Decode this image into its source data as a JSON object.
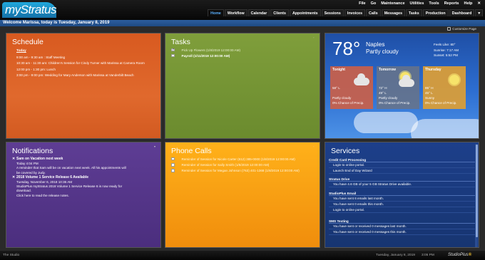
{
  "app": {
    "logo": "myStratus"
  },
  "top_menu": [
    "File",
    "Go",
    "Maintenance",
    "Utilities",
    "Tools",
    "Reports",
    "Help",
    "✕"
  ],
  "nav_tabs": [
    "Home",
    "Workflow",
    "Calendar",
    "Clients",
    "Appointments",
    "Sessions",
    "Invoices",
    "Calls",
    "Messages",
    "Tasks",
    "Production",
    "Dashboard",
    "▾"
  ],
  "active_tab": "Home",
  "welcome": "Welcome Marissa, today is Tuesday, January 8, 2019",
  "customize_label": "Customize Page",
  "schedule": {
    "title": "Schedule",
    "day_label": "Today",
    "items": [
      "9:00 am - 9:30 am : Staff Meeting",
      "10:30 am - 11:30 am: Children's Session for Cindy Turner with Marissa at Camera Room",
      "12:00 pm - 1:30 pm: Lunch",
      "3:00 pm - 9:00 pm: Wedding for Mary Anderson with Marissa at Vanderbilt Beach"
    ]
  },
  "tasks": {
    "title": "Tasks",
    "items": [
      {
        "label": "Pick Up Flowers (1/8/2019 12:00:00 AM)",
        "checked": true
      },
      {
        "label": "Payroll (1/11/2019 12:00:00 AM)",
        "checked": false
      }
    ]
  },
  "weather": {
    "temp": "78°",
    "city": "Naples",
    "condition": "Partly cloudy",
    "feels_like": "Feels Like: 80°",
    "sunrise": "Sunrise: 7:17 AM",
    "sunset": "Sunset: 5:52 PM",
    "forecast": [
      {
        "day": "Tonight",
        "hi": "58° L",
        "lo": "",
        "cond": "Partly cloudy",
        "precip": "0% Chance of Precip."
      },
      {
        "day": "Tomorrow",
        "hi": "72° H",
        "lo": "49° L",
        "cond": "Partly cloudy",
        "precip": "0% Chance of Precip."
      },
      {
        "day": "Thursday",
        "hi": "85° H",
        "lo": "45° L",
        "cond": "Sunny",
        "precip": "0% Chance of Precip."
      }
    ]
  },
  "notifications": {
    "title": "Notifications",
    "items": [
      {
        "title": "Sam on Vacation next week",
        "lines": [
          "Today 4:04 PM",
          "A reminder that Sam will be on vacation next week. All his appointments will",
          "be covered by Judy."
        ]
      },
      {
        "title": "2018 Volume 1 Service Release 6 Available",
        "lines": [
          "Tuesday, November 6, 2018 10:36 AM",
          "StudioPlus myStratus 2018 Volume 1 Service Release 6 is now ready for",
          "download.",
          "Click here to read the release notes."
        ]
      }
    ]
  },
  "phone_calls": {
    "title": "Phone Calls",
    "items": [
      "Reminder of Session for Nicole Carter (612) 385-0000 (1/8/2019 12:00:00 AM)",
      "Reminder of Session for Sally Smith (1/8/2019 12:00:00 AM)",
      "Reminder of Session for Megan Johnson (763) 401-1368 (1/8/2019 12:00:00 AM)"
    ]
  },
  "services": {
    "title": "Services",
    "sections": [
      {
        "head": "Credit Card Processing",
        "lines": [
          "Login to online portal.",
          "Launch End of Day Wizard"
        ]
      },
      {
        "head": "Stratus Drive",
        "lines": [
          "You have 4.6 GB of your 5 GB Stratus Drive available."
        ]
      },
      {
        "head": "StudioPlus Email",
        "lines": [
          "You have sent 6 emails last month.",
          "You have sent 0 emails this month.",
          "Login to online portal."
        ]
      },
      {
        "head": "SMS Texting",
        "lines": [
          "You have sent or received 0 messages last month.",
          "You have sent or received 0 messages this month."
        ]
      }
    ]
  },
  "status_bar": {
    "left": "The Studio",
    "date": "Tuesday, January 8, 2019",
    "time": "3:05 PM",
    "brand_a": "StudioPlus",
    "brand_b": "®"
  }
}
